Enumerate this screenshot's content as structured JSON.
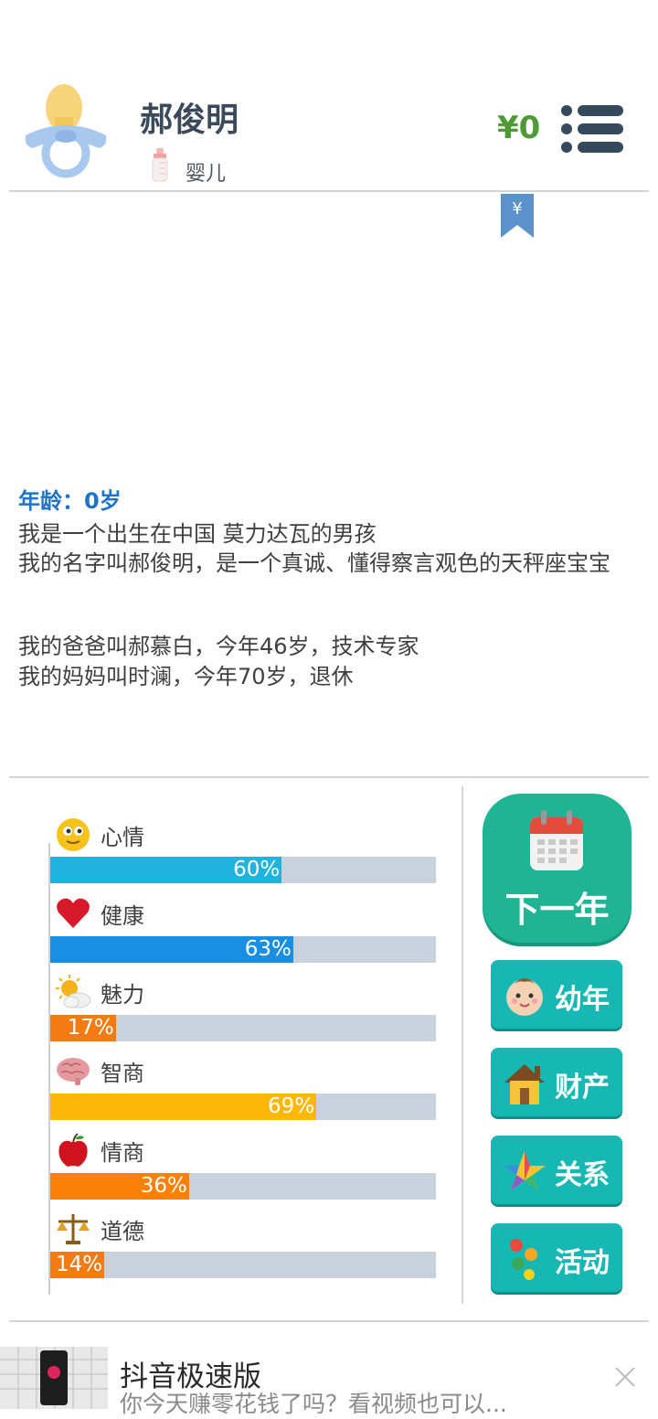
{
  "header": {
    "player_name": "郝俊明",
    "life_stage": "婴儿",
    "money": "¥0",
    "avatar_icon": "pacifier-icon",
    "stage_icon": "baby-bottle-icon",
    "menu_icon": "menu-list-icon",
    "bookmark_icon": "yen-bookmark-icon",
    "bookmark_symbol": "¥"
  },
  "story": {
    "age_line": "年龄：0岁",
    "lines": [
      "我是一个出生在中国 莫力达瓦的男孩",
      "我的名字叫郝俊明，是一个真诚、懂得察言观色的天秤座宝宝"
    ],
    "family_lines": [
      "我的爸爸叫郝慕白，今年46岁，技术专家",
      "我的妈妈叫时澜，今年70岁，退休"
    ]
  },
  "stats": [
    {
      "label": "心情",
      "percent_text": "60%",
      "value": 60,
      "color": "#1fb3de",
      "icon": "smiley-face-icon"
    },
    {
      "label": "健康",
      "percent_text": "63%",
      "value": 63,
      "color": "#1a8ee0",
      "icon": "heart-icon"
    },
    {
      "label": "魅力",
      "percent_text": "17%",
      "value": 17,
      "color": "#f47a12",
      "icon": "sun-cloud-icon"
    },
    {
      "label": "智商",
      "percent_text": "69%",
      "value": 69,
      "color": "#fdb706",
      "icon": "brain-icon"
    },
    {
      "label": "情商",
      "percent_text": "36%",
      "value": 36,
      "color": "#fb8008",
      "icon": "apple-icon"
    },
    {
      "label": "道德",
      "percent_text": "14%",
      "value": 14,
      "color": "#f47a12",
      "icon": "scales-icon"
    }
  ],
  "actions": {
    "next_year": {
      "label": "下一年",
      "icon": "calendar-icon"
    },
    "buttons": [
      {
        "label": "幼年",
        "icon": "baby-face-icon"
      },
      {
        "label": "财产",
        "icon": "house-icon"
      },
      {
        "label": "关系",
        "icon": "star-icon"
      },
      {
        "label": "活动",
        "icon": "activity-dots-icon"
      }
    ]
  },
  "ad": {
    "title": "抖音极速版",
    "description": "你今天赚零花钱了吗？看视频也可以...",
    "close_icon": "close-icon"
  }
}
